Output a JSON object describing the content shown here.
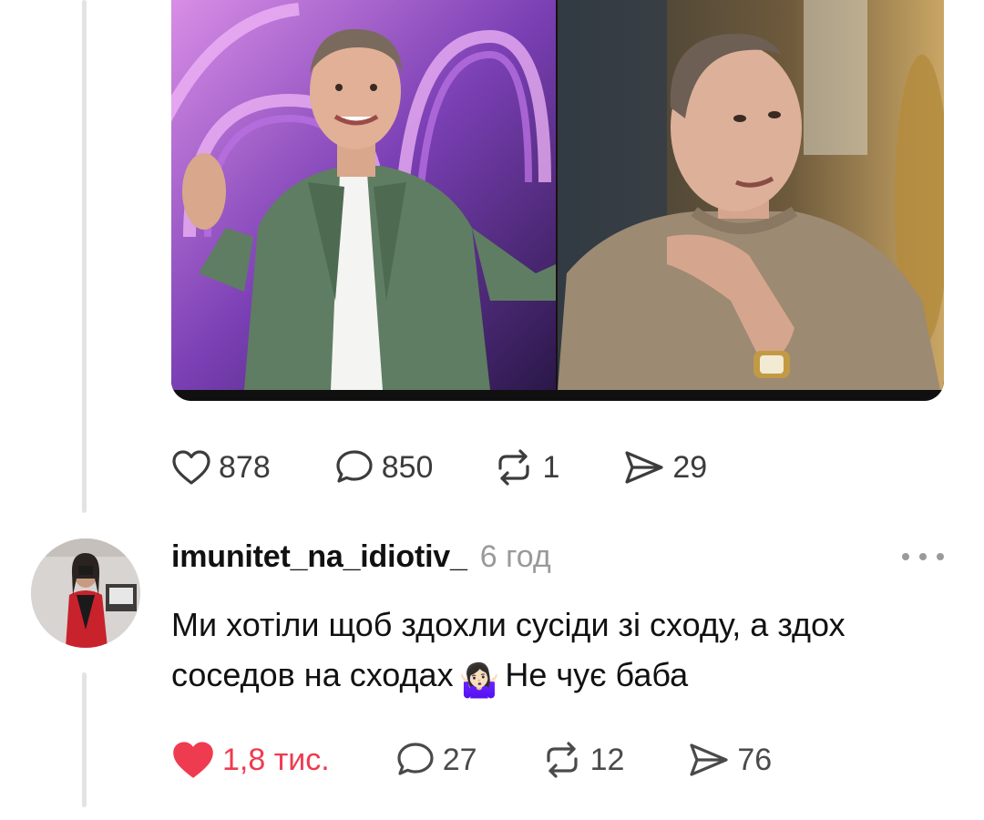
{
  "post": {
    "actions": {
      "likes": "878",
      "comments": "850",
      "reposts": "1",
      "shares": "29"
    }
  },
  "reply": {
    "username": "imunitet_na_idiotiv_",
    "timestamp": "6 год",
    "text_before_emoji": "Ми хотіли щоб здохли сусіди зі сходу, а здох соседов на сходах",
    "emoji": "🤷🏻‍♀️",
    "text_after_emoji": "Не чує баба",
    "liked": true,
    "actions": {
      "likes": "1,8 тис.",
      "comments": "27",
      "reposts": "12",
      "shares": "76"
    }
  },
  "colors": {
    "like_active": "#ef3b50",
    "icon": "#3c3c3c",
    "muted_text": "#9a9a9a",
    "thread_line": "#e3e3e3"
  },
  "icons": {
    "like": "heart-outline-icon",
    "like_active": "heart-filled-icon",
    "comment": "speech-bubble-icon",
    "repost": "repost-arrows-icon",
    "share": "paper-plane-icon",
    "more": "more-horizontal-icon"
  }
}
